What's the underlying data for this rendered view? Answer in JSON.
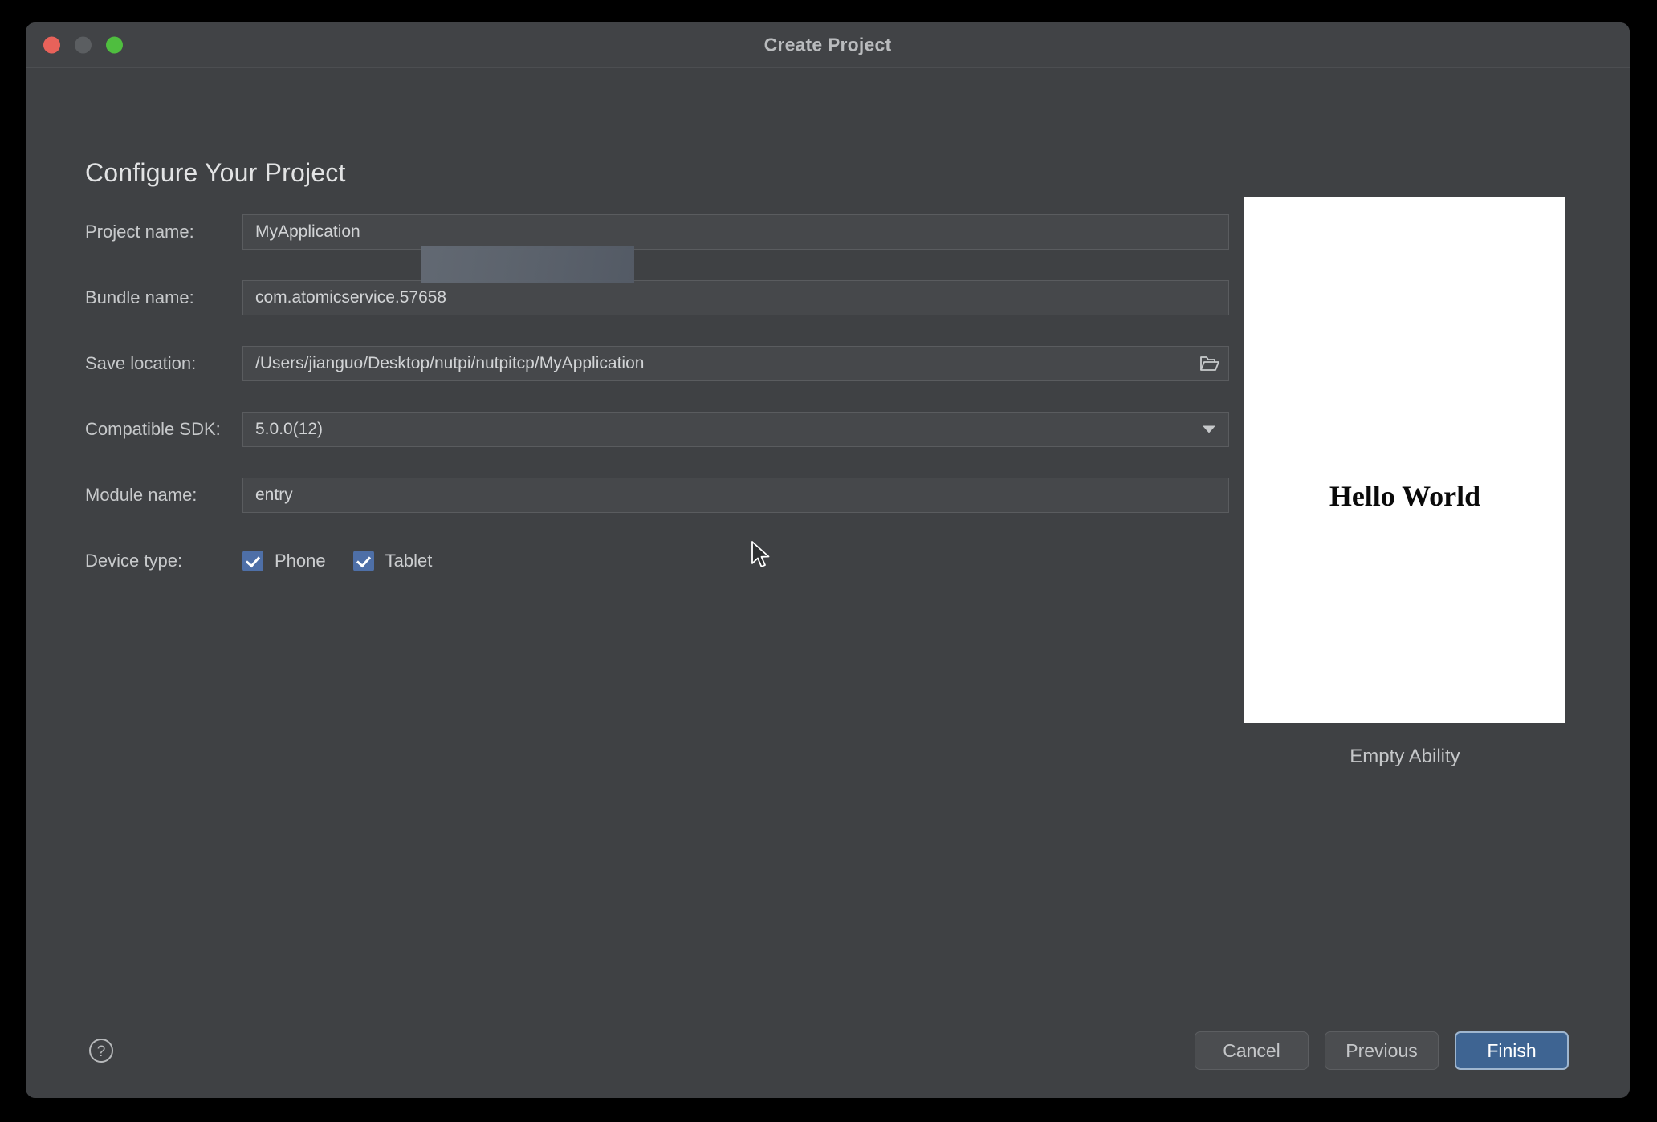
{
  "window": {
    "title": "Create Project",
    "traffic_lights": [
      {
        "name": "close",
        "color": "#e8625a"
      },
      {
        "name": "minimize",
        "color": "#5b5e61"
      },
      {
        "name": "zoom",
        "color": "#4fbe3f"
      }
    ]
  },
  "page": {
    "heading": "Configure Your Project"
  },
  "form": {
    "project_name": {
      "label": "Project name:",
      "value": "MyApplication"
    },
    "bundle_name": {
      "label": "Bundle name:",
      "value": "com.atomicservice.57658"
    },
    "save_location": {
      "label": "Save location:",
      "value": "/Users/jianguo/Desktop/nutpi/nutpitcp/MyApplication",
      "browse_icon": "open-folder-icon"
    },
    "compatible_sdk": {
      "label": "Compatible SDK:",
      "value": "5.0.0(12)",
      "dropdown_icon": "chevron-down-icon"
    },
    "module_name": {
      "label": "Module name:",
      "value": "entry"
    },
    "device_type": {
      "label": "Device type:",
      "options": [
        {
          "label": "Phone",
          "checked": true
        },
        {
          "label": "Tablet",
          "checked": true
        }
      ]
    }
  },
  "preview": {
    "screen_text": "Hello World",
    "caption": "Empty Ability"
  },
  "footer": {
    "help_icon": "question-mark-circle-icon",
    "cancel_label": "Cancel",
    "previous_label": "Previous",
    "finish_label": "Finish"
  },
  "colors": {
    "window_bg": "#3f4144",
    "field_bg": "#46484b",
    "accent_blue": "#4e6fa7",
    "primary_button": "#3e6492",
    "text": "#d2d4d6"
  }
}
